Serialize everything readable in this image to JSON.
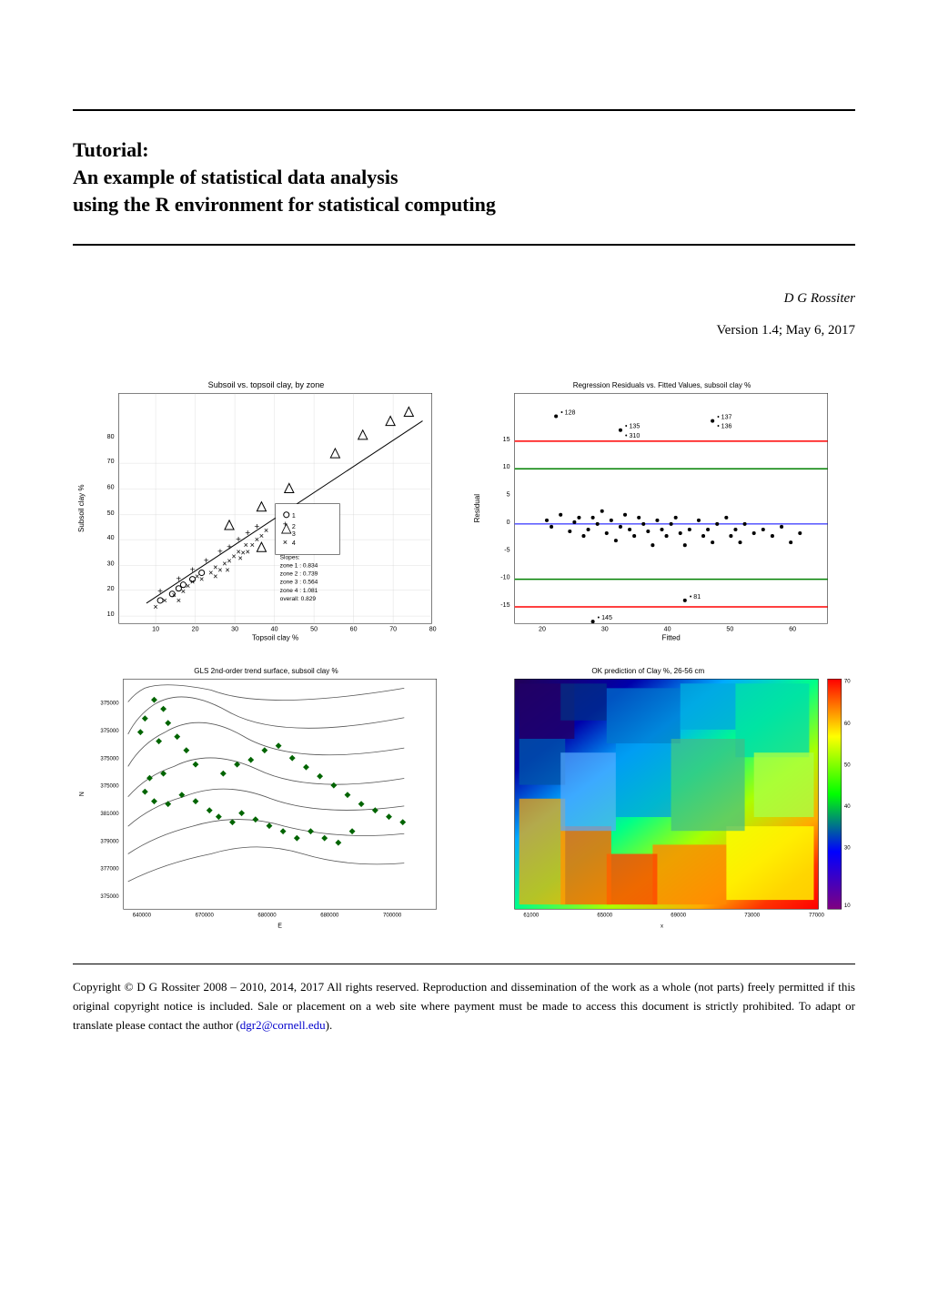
{
  "page": {
    "top_rule": true,
    "title_tutorial": "Tutorial:",
    "title_main": "An example of statistical data analysis",
    "title_sub": "using the R environment for statistical computing",
    "bottom_rule": true,
    "author": "D G Rossiter",
    "version": "Version 1.4; May 6, 2017",
    "copyright": "Copyright © D G Rossiter 2008 – 2010, 2014, 2017 All rights reserved. Reproduction and dissemination of the work as a whole (not parts) freely permitted if this original copyright notice is included. Sale or placement on a web site where payment must be made to access this document is strictly prohibited. To adapt or translate please contact the author (",
    "copyright_link": "dgr2@cornell.edu",
    "copyright_end": ").",
    "charts": [
      {
        "id": "chart1",
        "title": "Subsoil vs. topsoil clay, by zone",
        "type": "scatter"
      },
      {
        "id": "chart2",
        "title": "Regression Residuals vs. Fitted Values, subsoil clay %",
        "type": "residuals"
      },
      {
        "id": "chart3",
        "title": "GLS 2nd-order trend surface, subsoil clay %",
        "type": "contour"
      },
      {
        "id": "chart4",
        "title": "OK prediction of Clay %, 26-56 cm",
        "type": "heatmap"
      }
    ]
  }
}
